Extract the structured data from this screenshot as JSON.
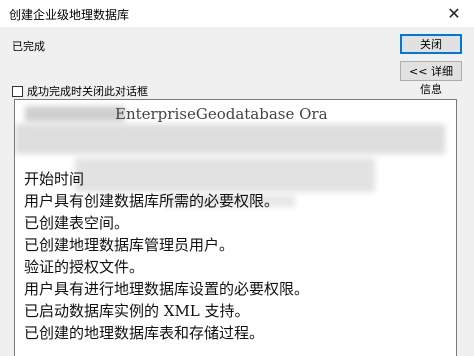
{
  "window": {
    "title": "创建企业级地理数据库",
    "close_glyph": "✕"
  },
  "status_text": "已完成",
  "buttons": {
    "close_label": "关闭",
    "details_label": "<< 详细信息"
  },
  "checkbox": {
    "label": "成功完成时关闭此对话框",
    "checked": false
  },
  "log": {
    "lines": [
      "EnterpriseGeodatabase Ora",
      "开始时间",
      "用户具有创建数据库所需的必要权限。",
      "已创建表空间。",
      "已创建地理数据库管理员用户。",
      "验证的授权文件。",
      "用户具有进行地理数据库设置的必要权限。",
      "已启动数据库实例的 XML 支持。",
      "已创建的地理数据库表和存储过程。"
    ]
  }
}
